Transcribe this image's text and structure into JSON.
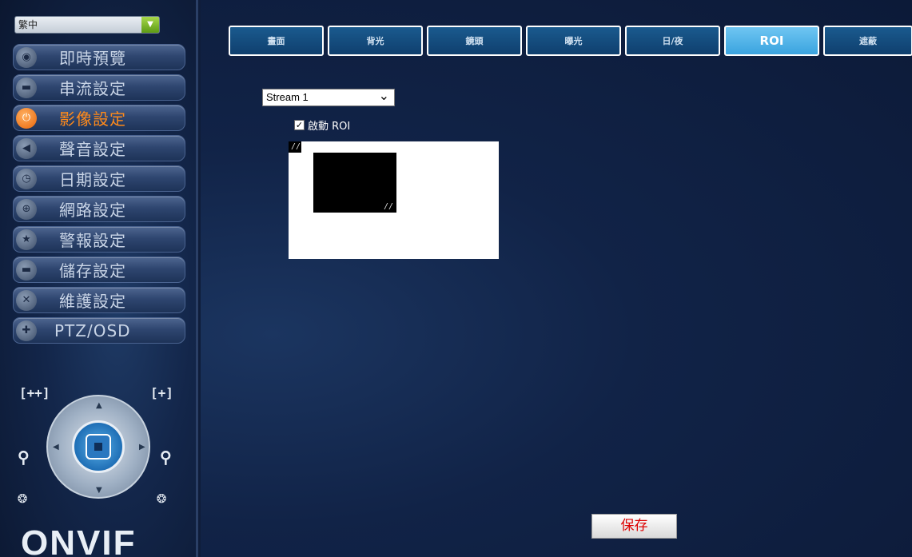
{
  "sidebar": {
    "language": "繁中",
    "menu": [
      {
        "label": "即時預覽",
        "icon": "live-view-icon",
        "active": false
      },
      {
        "label": "串流設定",
        "icon": "stream-icon",
        "active": false
      },
      {
        "label": "影像設定",
        "icon": "power-icon",
        "active": true
      },
      {
        "label": "聲音設定",
        "icon": "speaker-icon",
        "active": false
      },
      {
        "label": "日期設定",
        "icon": "clock-icon",
        "active": false
      },
      {
        "label": "網路設定",
        "icon": "network-icon",
        "active": false
      },
      {
        "label": "警報設定",
        "icon": "alarm-icon",
        "active": false
      },
      {
        "label": "儲存設定",
        "icon": "storage-icon",
        "active": false
      },
      {
        "label": "維護設定",
        "icon": "tools-icon",
        "active": false
      },
      {
        "label": "PTZ/OSD",
        "icon": "ptz-icon",
        "active": false
      }
    ],
    "ptz": {
      "left_label": "[++]",
      "right_label": "[+]"
    },
    "logo": "ONVIF"
  },
  "tabs": [
    {
      "label": "畫面",
      "active": false
    },
    {
      "label": "背光",
      "active": false
    },
    {
      "label": "鏡頭",
      "active": false
    },
    {
      "label": "曝光",
      "active": false
    },
    {
      "label": "日/夜",
      "active": false
    },
    {
      "label": "ROI",
      "active": true
    },
    {
      "label": "遮蔽",
      "active": false
    }
  ],
  "roi": {
    "stream_select": "Stream 1",
    "enable_label": "啟動 ROI",
    "enabled": true
  },
  "save_label": "保存",
  "colors": {
    "accent": "#ff8a1a",
    "tab_active": "#3aa3df",
    "tab_inactive": "#0f3f6e",
    "save_text": "#dd0000"
  }
}
